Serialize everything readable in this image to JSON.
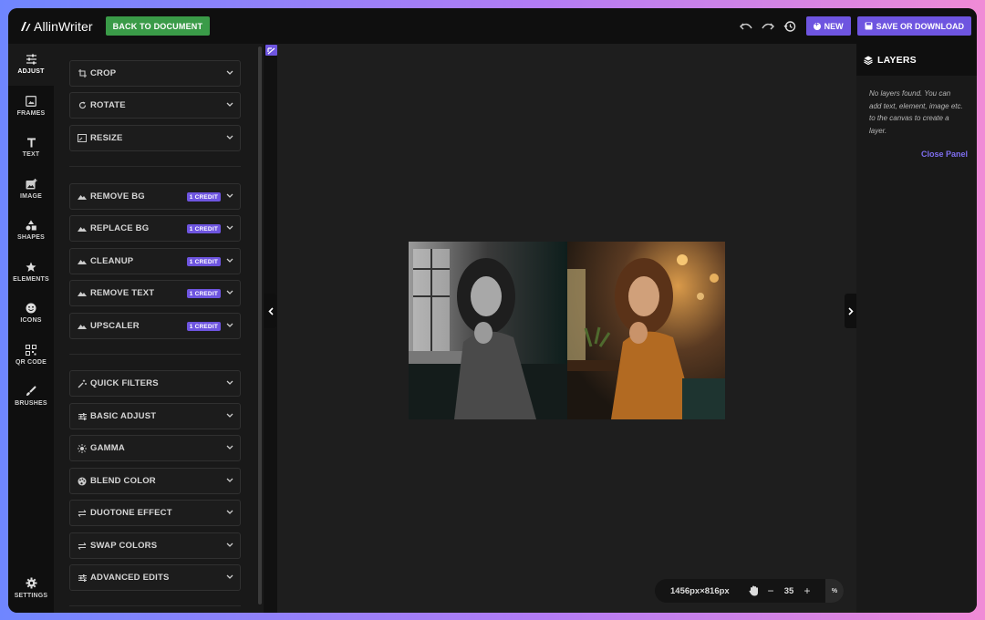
{
  "header": {
    "logo_text": "AllinWriter",
    "back_label": "BACK TO DOCUMENT",
    "new_label": "NEW",
    "save_label": "SAVE OR DOWNLOAD",
    "icons": [
      "undo-icon",
      "redo-icon",
      "history-icon"
    ]
  },
  "rail": {
    "items": [
      {
        "label": "ADJUST",
        "icon": "sliders-icon"
      },
      {
        "label": "FRAMES",
        "icon": "frame-icon"
      },
      {
        "label": "TEXT",
        "icon": "text-icon"
      },
      {
        "label": "IMAGE",
        "icon": "image-add-icon"
      },
      {
        "label": "SHAPES",
        "icon": "shapes-icon"
      },
      {
        "label": "ELEMENTS",
        "icon": "star-icon"
      },
      {
        "label": "ICONS",
        "icon": "smiley-icon"
      },
      {
        "label": "QR CODE",
        "icon": "qr-code-icon"
      },
      {
        "label": "BRUSHES",
        "icon": "brush-icon"
      }
    ],
    "settings_label": "SETTINGS"
  },
  "tools": {
    "group1": [
      {
        "label": "CROP",
        "icon": "crop-icon"
      },
      {
        "label": "ROTATE",
        "icon": "rotate-icon"
      },
      {
        "label": "RESIZE",
        "icon": "resize-icon"
      }
    ],
    "group2": [
      {
        "label": "REMOVE BG",
        "icon": "mountain-icon",
        "badge": "1 CREDIT"
      },
      {
        "label": "REPLACE BG",
        "icon": "mountain-icon",
        "badge": "1 CREDIT"
      },
      {
        "label": "CLEANUP",
        "icon": "mountain-icon",
        "badge": "1 CREDIT"
      },
      {
        "label": "REMOVE TEXT",
        "icon": "mountain-icon",
        "badge": "1 CREDIT"
      },
      {
        "label": "UPSCALER",
        "icon": "mountain-icon",
        "badge": "1 CREDIT"
      }
    ],
    "group3": [
      {
        "label": "QUICK FILTERS",
        "icon": "magic-wand-icon"
      },
      {
        "label": "BASIC ADJUST",
        "icon": "sliders-icon"
      },
      {
        "label": "GAMMA",
        "icon": "sun-icon"
      },
      {
        "label": "BLEND COLOR",
        "icon": "palette-icon"
      },
      {
        "label": "DUOTONE EFFECT",
        "icon": "swap-icon"
      },
      {
        "label": "SWAP COLORS",
        "icon": "swap-icon"
      },
      {
        "label": "ADVANCED EDITS",
        "icon": "sliders-icon"
      }
    ]
  },
  "canvas": {
    "image_description_icon": "photo-canvas",
    "dimensions": "1456px×816px",
    "zoom": "35",
    "zoom_unit": "%"
  },
  "layers": {
    "title": "LAYERS",
    "empty_message": "No layers found. You can add text, element, image etc. to the canvas to create a layer.",
    "close_label": "Close Panel"
  },
  "colors": {
    "accent": "#6e55e0",
    "back_button": "#3a9b48",
    "close_link": "#7e6ef0"
  }
}
